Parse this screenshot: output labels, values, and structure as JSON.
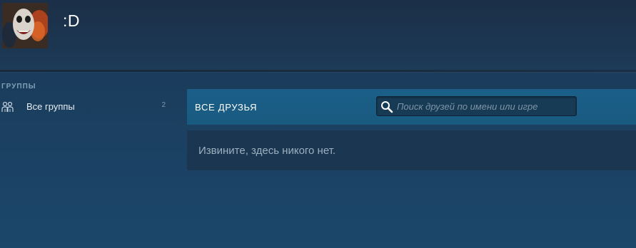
{
  "profile": {
    "username": ":D",
    "avatar_icon": "avatar-joker-icon"
  },
  "sidebar": {
    "groups_heading": "ГРУППЫ",
    "items": [
      {
        "label": "Все группы",
        "count": "2",
        "icon": "users-icon"
      }
    ]
  },
  "friends": {
    "title": "ВСЕ ДРУЗЬЯ",
    "search": {
      "placeholder": "Поиск друзей по имени или игре",
      "value": "",
      "icon": "search-icon"
    },
    "empty_message": "Извините, здесь никого нет."
  },
  "colors": {
    "accent_bar": "#1a5b82",
    "background": "#1b3e5e",
    "panel": "#1a3650"
  }
}
